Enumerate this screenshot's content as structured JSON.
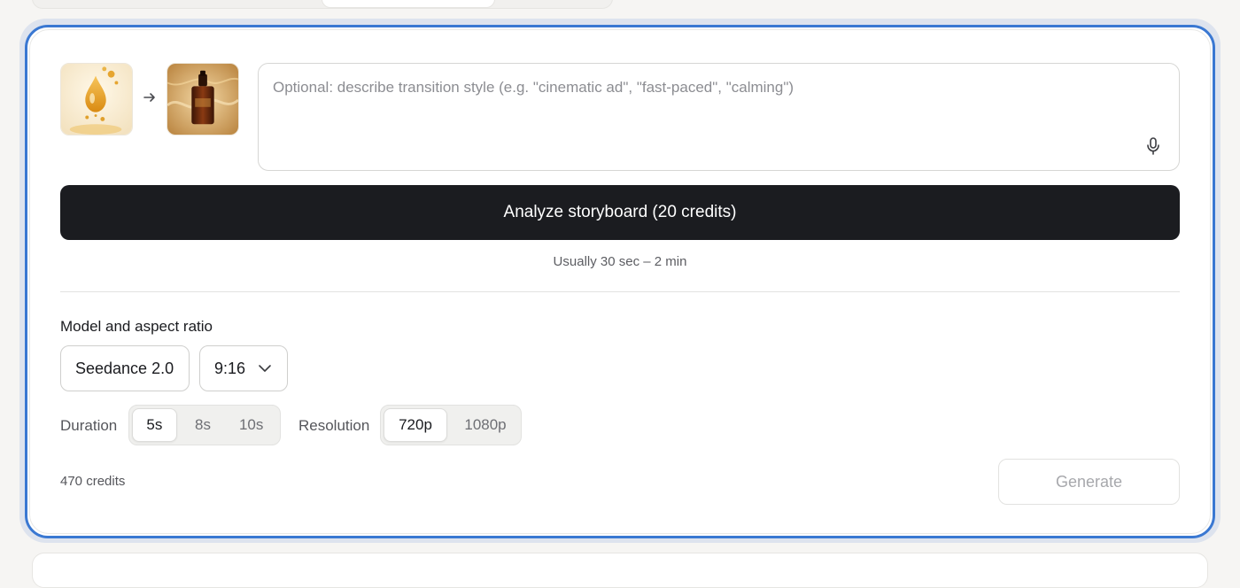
{
  "storyboard": {
    "start_frame": {
      "icon": "honey-drop-image"
    },
    "arrow": {
      "icon": "arrow-right-icon"
    },
    "end_frame": {
      "icon": "serum-bottle-image"
    }
  },
  "prompt": {
    "value": "",
    "placeholder": "Optional: describe transition style (e.g. \"cinematic ad\", \"fast-paced\", \"calming\")",
    "mic_icon": "microphone-icon"
  },
  "analyze": {
    "label": "Analyze storyboard (20 credits)",
    "hint": "Usually 30 sec – 2 min"
  },
  "settings": {
    "section_label": "Model and aspect ratio",
    "model": {
      "value": "Seedance 2.0"
    },
    "aspect_ratio": {
      "value": "9:16",
      "icon": "chevron-down-icon"
    },
    "duration": {
      "label": "Duration",
      "options": [
        "5s",
        "8s",
        "10s"
      ],
      "selected": "5s"
    },
    "resolution": {
      "label": "Resolution",
      "options": [
        "720p",
        "1080p"
      ],
      "selected": "720p"
    }
  },
  "footer": {
    "credits": "470 credits",
    "generate_label": "Generate"
  },
  "colors": {
    "accent_border": "#3a78d2",
    "primary_button": "#1b1c20",
    "disabled_text": "#a7a8ac"
  }
}
